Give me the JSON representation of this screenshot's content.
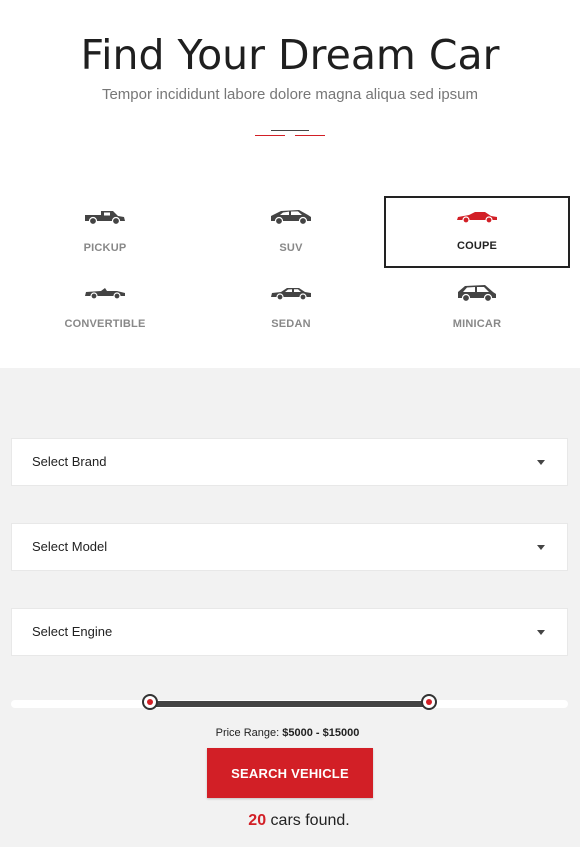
{
  "header": {
    "title": "Find Your Dream Car",
    "subtitle": "Tempor incididunt labore dolore magna aliqua sed ipsum"
  },
  "vehicle_types": [
    {
      "label": "PICKUP",
      "icon": "pickup-icon",
      "active": false
    },
    {
      "label": "SUV",
      "icon": "suv-icon",
      "active": false
    },
    {
      "label": "COUPE",
      "icon": "coupe-icon",
      "active": true
    },
    {
      "label": "CONVERTIBLE",
      "icon": "convertible-icon",
      "active": false
    },
    {
      "label": "SEDAN",
      "icon": "sedan-icon",
      "active": false
    },
    {
      "label": "MINICAR",
      "icon": "minicar-icon",
      "active": false
    }
  ],
  "filters": {
    "brand_label": "Select Brand",
    "model_label": "Select Model",
    "engine_label": "Select Engine"
  },
  "price": {
    "label": "Price Range:",
    "min": "$5000",
    "separator": "-",
    "max": "$15000",
    "slider_min_fraction": 0.25,
    "slider_max_fraction": 0.75
  },
  "search_button": "SEARCH VEHICLE",
  "results": {
    "count": "20",
    "suffix": "cars found."
  },
  "colors": {
    "accent": "#d21f26",
    "icon": "#444444",
    "background_lower": "#f2f2f2"
  }
}
